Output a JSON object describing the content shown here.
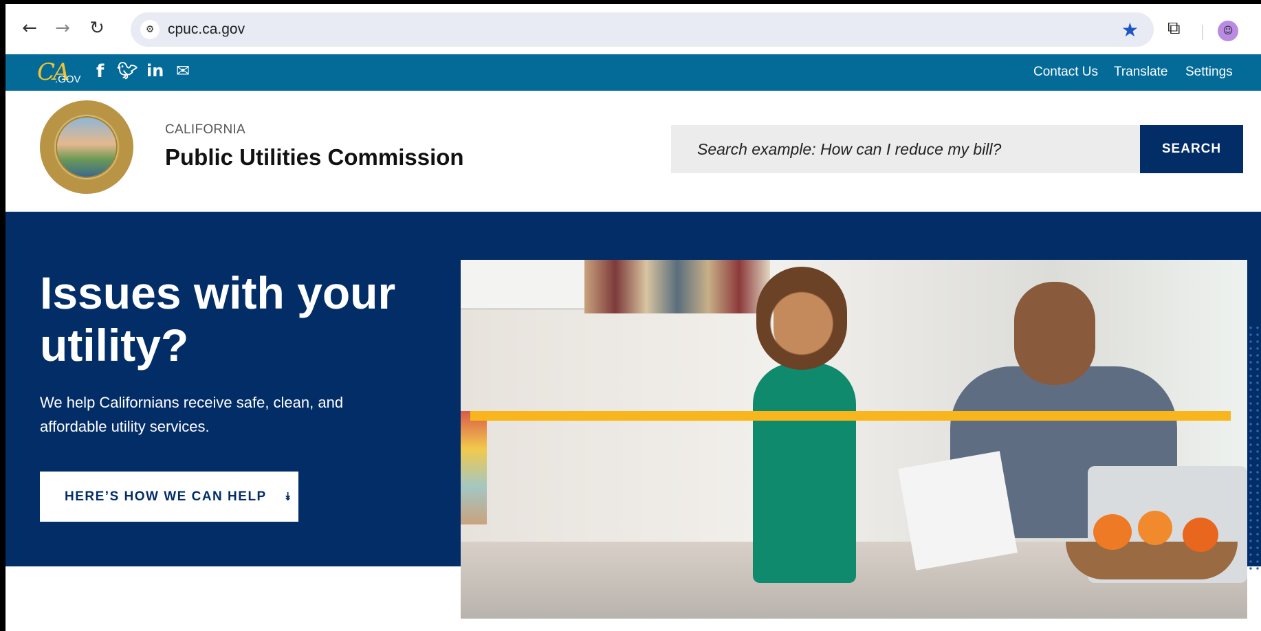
{
  "browser": {
    "url": "cpuc.ca.gov",
    "back_icon": "arrow-left-icon",
    "forward_icon": "arrow-right-icon",
    "reload_icon": "reload-icon",
    "bookmark_icon": "star-icon",
    "extensions_icon": "puzzle-icon"
  },
  "utility_bar": {
    "logo_text": "CA",
    "logo_sub": ".GOV",
    "social": [
      "facebook-icon",
      "twitter-icon",
      "linkedin-icon",
      "email-icon"
    ],
    "links": [
      "Contact Us",
      "Translate",
      "Settings"
    ]
  },
  "header": {
    "org_small": "CALIFORNIA",
    "org_name": "Public Utilities Commission",
    "search_placeholder": "Search example: How can I reduce my bill?",
    "search_button": "SEARCH"
  },
  "hero": {
    "title": "Issues with your utility?",
    "subtitle": "We help Californians receive safe, clean, and affordable utility services.",
    "button": "HERE’S HOW WE CAN HELP"
  },
  "colors": {
    "utility_bar": "#046b99",
    "primary_navy": "#032d67",
    "accent_gold": "#f9b51c"
  }
}
